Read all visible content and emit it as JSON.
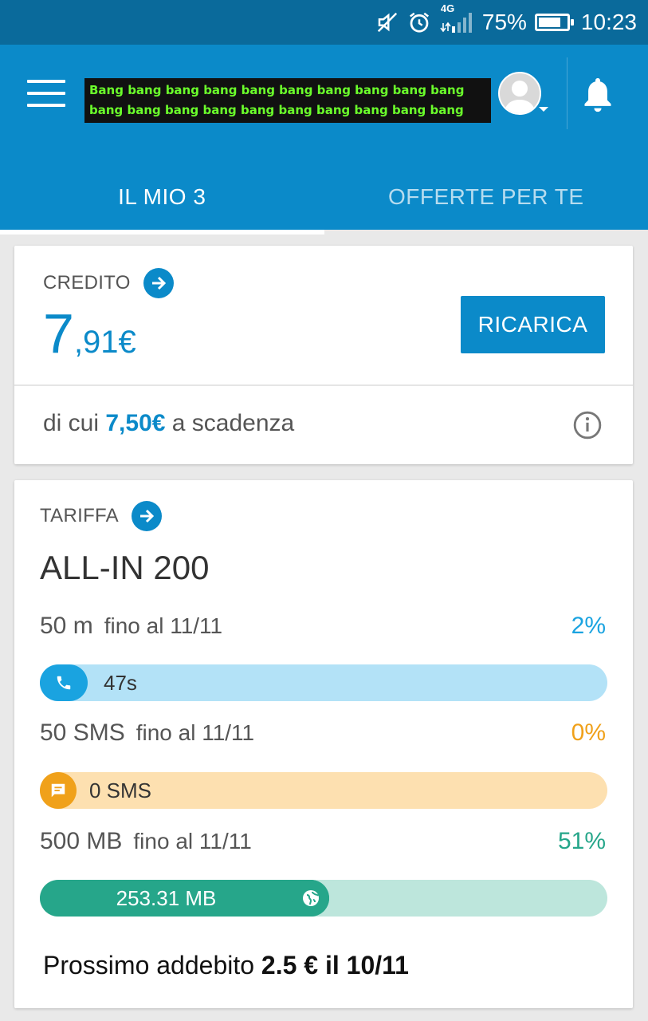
{
  "status_bar": {
    "battery": "75%",
    "time": "10:23",
    "network": "4G",
    "icons": [
      "mute-icon",
      "alarm-icon",
      "signal-icon",
      "battery-icon"
    ]
  },
  "header": {
    "banner_text": "Bang bang bang bang bang bang bang bang bang bang bang bang bang bang bang bang bang bang bang bang bang bang...",
    "tabs": [
      {
        "label": "IL MIO 3",
        "active": true
      },
      {
        "label": "OFFERTE PER TE",
        "active": false
      }
    ]
  },
  "credit": {
    "label": "CREDITO",
    "amount_int": "7",
    "amount_dec": ",91€",
    "recharge_label": "RICARICA",
    "expiring_prefix": "di cui ",
    "expiring_amount": "7,50€",
    "expiring_suffix": " a scadenza"
  },
  "plan": {
    "label": "TARIFFA",
    "name": "ALL-IN 200",
    "allowances": [
      {
        "amount": "50 m",
        "until": "fino al 11/11",
        "percent": "2%",
        "used_text": "47s",
        "fill": 0.02,
        "color": "#1aa3e0",
        "track": "#b3e2f7",
        "icon": "phone-icon"
      },
      {
        "amount": "50 SMS",
        "until": "fino al 11/11",
        "percent": "0%",
        "used_text": "0 SMS",
        "fill": 0.0,
        "color": "#f0a11a",
        "track": "#fde0b0",
        "icon": "message-icon"
      },
      {
        "amount": "500 MB",
        "until": "fino al 11/11",
        "percent": "51%",
        "used_text": "253.31 MB",
        "fill": 0.51,
        "color": "#26a68a",
        "track": "#bde6dc",
        "icon": "globe-icon"
      }
    ],
    "next_charge_prefix": "Prossimo addebito ",
    "next_charge_value": "2.5 € il 10/11"
  },
  "colors": {
    "primary": "#0b8ac9",
    "statusbar": "#0a6a9b"
  }
}
